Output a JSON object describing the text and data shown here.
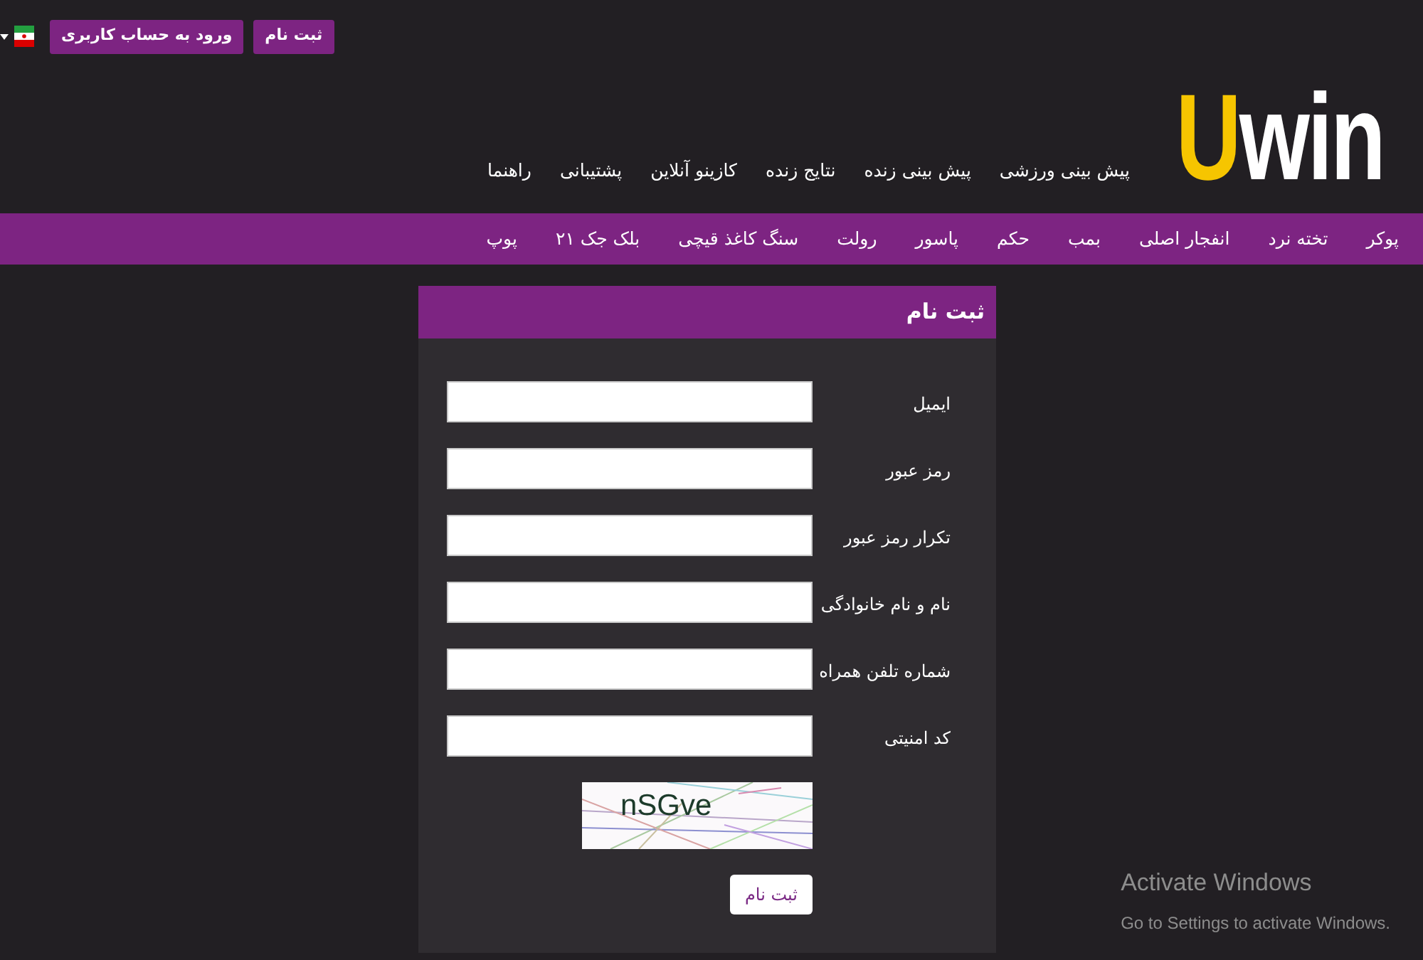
{
  "top_bar": {
    "buttons": [
      {
        "label": "ثبت نام"
      },
      {
        "label": "ورود به حساب کاربری"
      }
    ]
  },
  "header": {
    "logo": "Uwin",
    "nav": [
      "پیش بینی ورزشی",
      "پیش بینی زنده",
      "نتایج زنده",
      "کازینو آنلاین",
      "پشتیبانی",
      "راهنما"
    ]
  },
  "games_bar": {
    "items": [
      "پوکر",
      "تخته نرد",
      "انفجار اصلی",
      "بمب",
      "حکم",
      "پاسور",
      "رولت",
      "سنگ کاغذ قیچی",
      "بلک جک ۲۱",
      "پوپ"
    ]
  },
  "registration_form": {
    "title": "ثبت نام",
    "fields": [
      {
        "label": "ایمیل"
      },
      {
        "label": "رمز عبور"
      },
      {
        "label": "تکرار رمز عبور"
      },
      {
        "label": "نام و نام خانوادگی"
      },
      {
        "label": "شماره تلفن همراه"
      },
      {
        "label": "کد امنیتی"
      }
    ],
    "captcha": "nSGve",
    "submit": "ثبت نام"
  },
  "os_notice": {
    "title": "Activate Windows",
    "subtitle": "Go to Settings to activate Windows."
  }
}
